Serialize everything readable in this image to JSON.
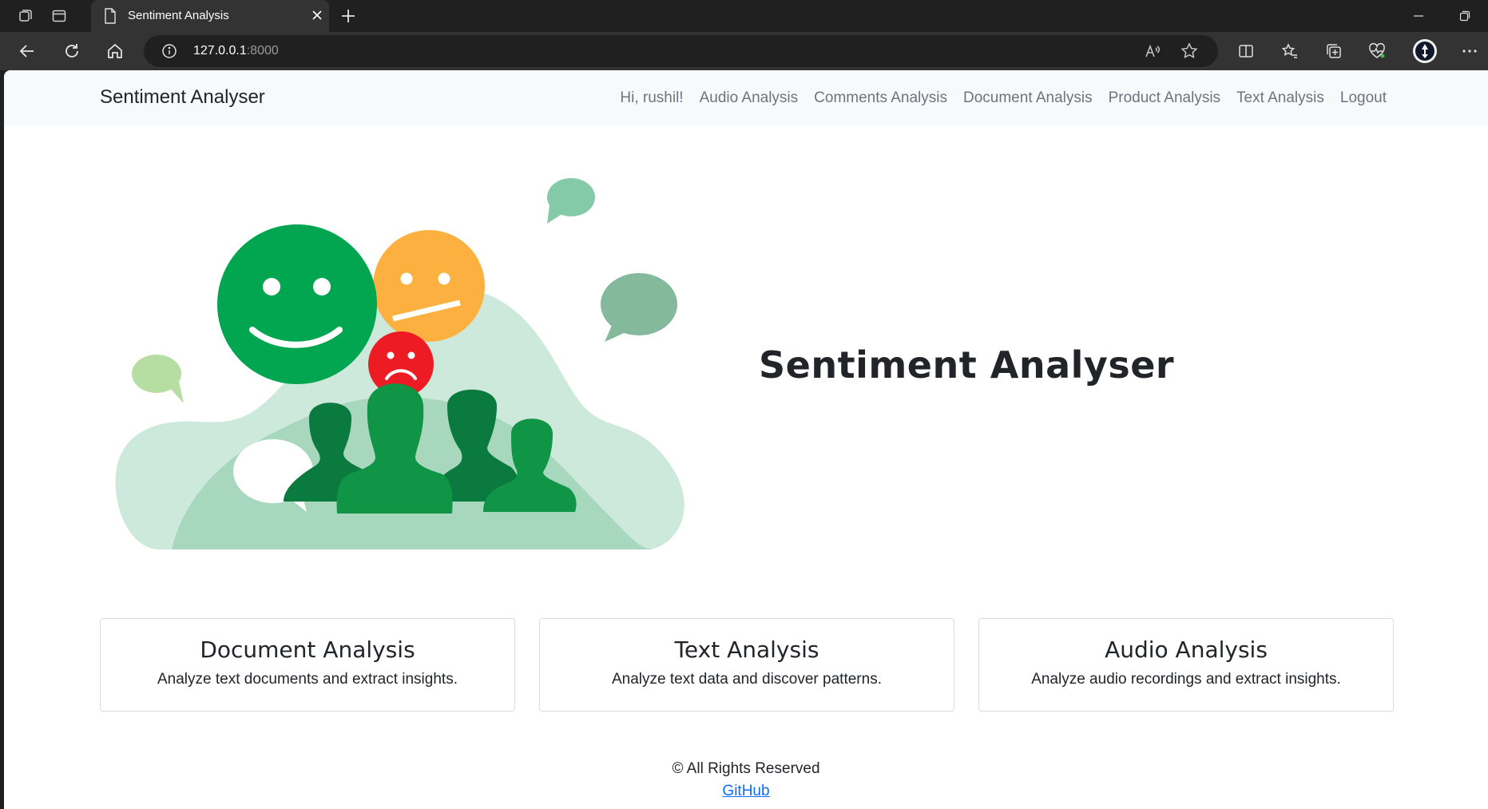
{
  "browser": {
    "tab_title": "Sentiment Analysis",
    "url_host": "127.0.0.1",
    "url_port": ":8000"
  },
  "navbar": {
    "brand": "Sentiment Analyser",
    "greeting": "Hi, rushil!",
    "links": [
      "Audio Analysis",
      "Comments Analysis",
      "Document Analysis",
      "Product Analysis",
      "Text Analysis",
      "Logout"
    ]
  },
  "hero": {
    "title": "Sentiment Analyser"
  },
  "cards": [
    {
      "title": "Document Analysis",
      "text": "Analyze text documents and extract insights."
    },
    {
      "title": "Text Analysis",
      "text": "Analyze text data and discover patterns."
    },
    {
      "title": "Audio Analysis",
      "text": "Analyze audio recordings and extract insights."
    }
  ],
  "footer": {
    "copyright": "© All Rights Reserved",
    "link": "GitHub"
  },
  "colors": {
    "happy": "#03a650",
    "neutral": "#fbb040",
    "sad": "#ed1c24",
    "bubble_teal": "#84caa9",
    "link": "#0d6efd"
  }
}
